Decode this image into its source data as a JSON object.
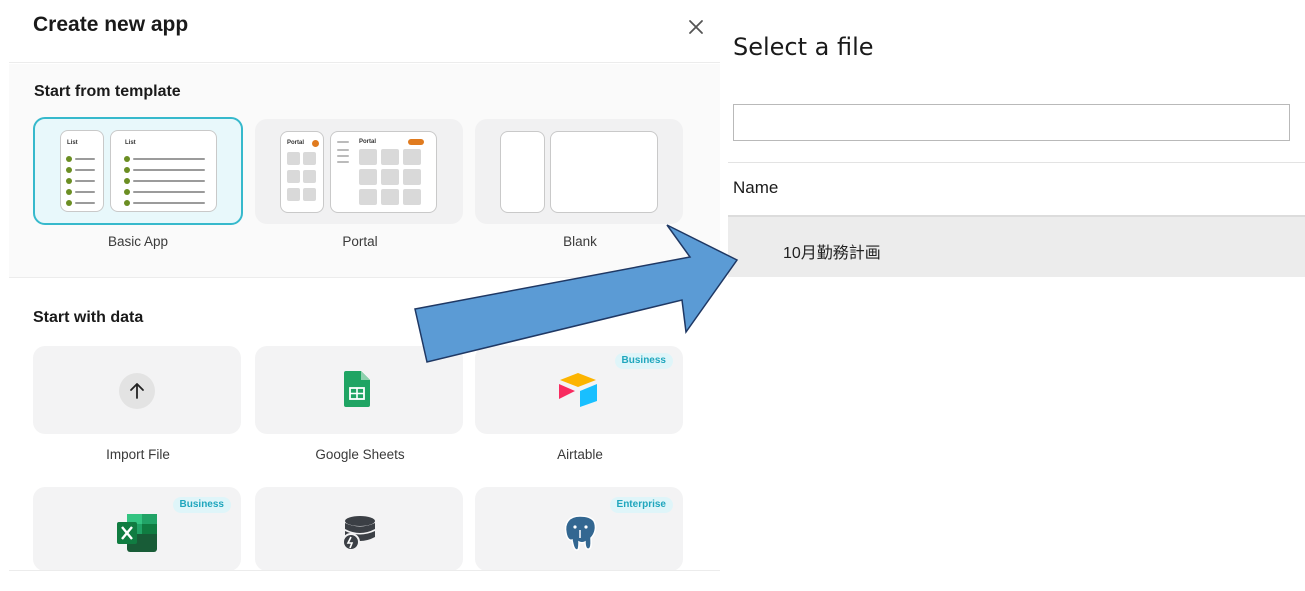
{
  "dialog": {
    "title": "Create new app",
    "close_icon": "close-icon",
    "template_section_title": "Start from template",
    "templates": [
      {
        "label": "Basic App",
        "selected": true,
        "preview_text_1": "List",
        "preview_text_2": "List"
      },
      {
        "label": "Portal",
        "selected": false,
        "preview_text_1": "Portal",
        "preview_text_2": "Portal"
      },
      {
        "label": "Blank",
        "selected": false
      }
    ],
    "data_section_title": "Start with data",
    "sources": [
      {
        "label": "Import File",
        "icon": "upload-arrow-icon",
        "badge": ""
      },
      {
        "label": "Google Sheets",
        "icon": "google-sheets-icon",
        "badge": ""
      },
      {
        "label": "Airtable",
        "icon": "airtable-icon",
        "badge": "Business"
      },
      {
        "label": "",
        "icon": "excel-icon",
        "badge": "Business"
      },
      {
        "label": "",
        "icon": "database-icon",
        "badge": ""
      },
      {
        "label": "",
        "icon": "postgresql-icon",
        "badge": "Enterprise"
      }
    ],
    "colors": {
      "accent": "#36b9cc",
      "badge_text": "#1fa6bd",
      "badge_bg": "#dff5f9"
    }
  },
  "file_picker": {
    "title": "Select a file",
    "search_value": "",
    "column_header": "Name",
    "files": [
      {
        "name": "10月勤務計画"
      }
    ]
  },
  "annotation": {
    "arrow_color": "#5b9bd5",
    "arrow_icon": "callout-arrow-icon"
  }
}
